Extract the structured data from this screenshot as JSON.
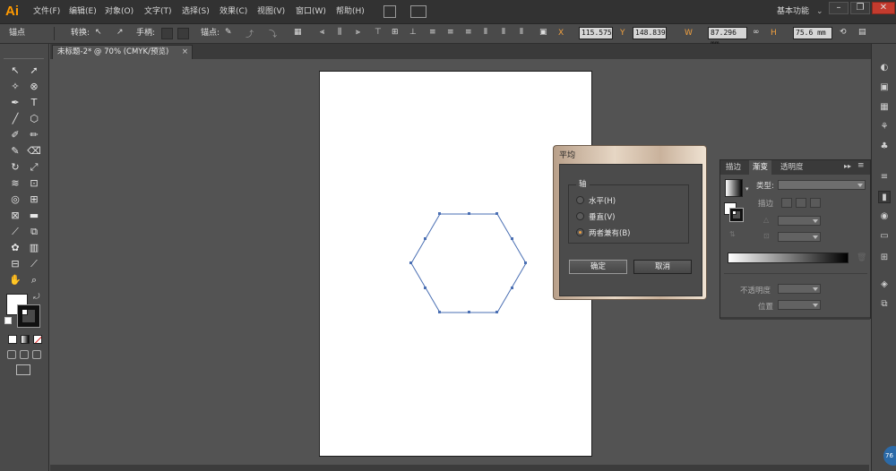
{
  "app": {
    "logo": "Ai"
  },
  "menu": [
    {
      "label": "文件(F)"
    },
    {
      "label": "编辑(E)"
    },
    {
      "label": "对象(O)"
    },
    {
      "label": "文字(T)"
    },
    {
      "label": "选择(S)"
    },
    {
      "label": "效果(C)"
    },
    {
      "label": "视图(V)"
    },
    {
      "label": "窗口(W)"
    },
    {
      "label": "帮助(H)"
    }
  ],
  "workspace": {
    "label": "基本功能"
  },
  "control_bar": {
    "selection_label": "锚点",
    "convert_label": "转换:",
    "handles_label": "手柄:",
    "anchor_label": "锚点:",
    "x": "115.575",
    "y": "148.839",
    "w": "87.296 mm",
    "h": "75.6 mm"
  },
  "document_tab": {
    "title": "未标题-2* @ 70% (CMYK/预览)",
    "close": "×"
  },
  "dialog": {
    "title": "平均",
    "group_label": "轴",
    "options": [
      {
        "label": "水平(H)",
        "selected": false
      },
      {
        "label": "垂直(V)",
        "selected": false
      },
      {
        "label": "两者兼有(B)",
        "selected": true
      }
    ],
    "ok": "确定",
    "cancel": "取消"
  },
  "gradient_panel": {
    "tabs": [
      {
        "label": "描边"
      },
      {
        "label": "渐变"
      },
      {
        "label": "透明度"
      }
    ],
    "active_tab": "渐变",
    "type_label": "类型:",
    "stroke_label": "描边",
    "opacity_label": "不透明度",
    "location_label": "位置"
  },
  "badge": {
    "label": "76"
  },
  "colors": {
    "accent": "#ff9a00",
    "path": "#4a6fb3",
    "dialog_frame": "#d8c4ae"
  }
}
